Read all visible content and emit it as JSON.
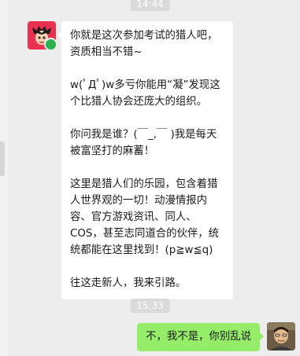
{
  "timestamps": {
    "top": "14:44",
    "middle": "15:33"
  },
  "incoming": {
    "avatar_icon": "hunter-boy-avatar-icon",
    "paragraphs": [
      "你就是这次参加考试的猎人吧，资质相当不错~",
      "w(ﾟДﾟ)w多亏你能用“凝”发现这个比猎人协会还庞大的组织。",
      "你问我是谁？(￣_,￣ )我是每天被富坚打的麻蓄！",
      "这里是猎人们的乐园，包含着猎人世界观的一切！动漫情报内容、官方游戏资讯、同人、COS，甚至志同道合的伙伴，统统都能在这里找到！(p≧w≦q)",
      "往这走新人，我来引路。"
    ]
  },
  "outgoing": {
    "avatar_icon": "user-photo-avatar",
    "text": "不，我不是，你别乱说"
  },
  "colors": {
    "background": "#ededed",
    "incoming_bubble": "#ffffff",
    "outgoing_bubble": "#95ec69",
    "avatar_bg": "#e8324f"
  }
}
